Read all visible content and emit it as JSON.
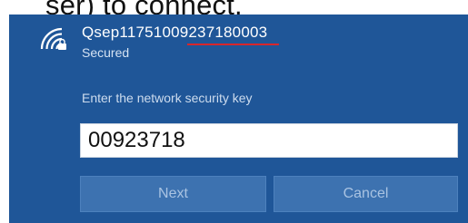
{
  "caption": "ser) to connect.",
  "network": {
    "name": "Qsep11751009237180003",
    "status": "Secured",
    "icon": "wifi-secured-icon"
  },
  "security_key": {
    "prompt": "Enter the network security key",
    "value": "00923718"
  },
  "buttons": {
    "next": "Next",
    "cancel": "Cancel"
  },
  "colors": {
    "panel_background": "#1f5698",
    "button_background": "#3d72b0",
    "underline": "#d8262b"
  }
}
